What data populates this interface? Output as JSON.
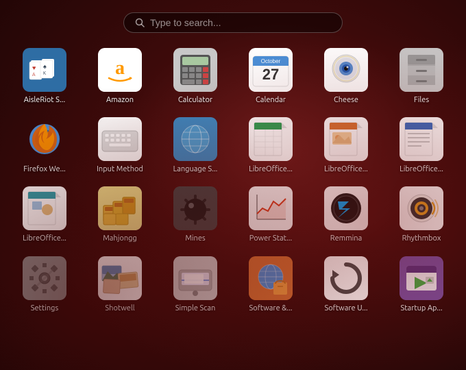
{
  "search": {
    "placeholder": "Type to search..."
  },
  "apps": [
    {
      "id": "aisleriot",
      "label": "AisleRiot S..."
    },
    {
      "id": "amazon",
      "label": "Amazon"
    },
    {
      "id": "calculator",
      "label": "Calculator"
    },
    {
      "id": "calendar",
      "label": "Calendar"
    },
    {
      "id": "cheese",
      "label": "Cheese"
    },
    {
      "id": "files",
      "label": "Files"
    },
    {
      "id": "firefox",
      "label": "Firefox We..."
    },
    {
      "id": "inputmethod",
      "label": "Input Method"
    },
    {
      "id": "language",
      "label": "Language S..."
    },
    {
      "id": "libreoffice-calc",
      "label": "LibreOffice..."
    },
    {
      "id": "libreoffice-impress",
      "label": "LibreOffice..."
    },
    {
      "id": "libreoffice-writer",
      "label": "LibreOffice..."
    },
    {
      "id": "libreoffice-draw",
      "label": "LibreOffice..."
    },
    {
      "id": "mahjongg",
      "label": "Mahjongg"
    },
    {
      "id": "mines",
      "label": "Mines"
    },
    {
      "id": "powerstat",
      "label": "Power Stat..."
    },
    {
      "id": "remmina",
      "label": "Remmina"
    },
    {
      "id": "rhythmbox",
      "label": "Rhythmbox"
    },
    {
      "id": "settings",
      "label": "Settings"
    },
    {
      "id": "shotwell",
      "label": "Shotwell"
    },
    {
      "id": "simplescan",
      "label": "Simple Scan"
    },
    {
      "id": "softwareand",
      "label": "Software &..."
    },
    {
      "id": "softwareupdate",
      "label": "Software U..."
    },
    {
      "id": "startup",
      "label": "Startup Ap..."
    }
  ]
}
